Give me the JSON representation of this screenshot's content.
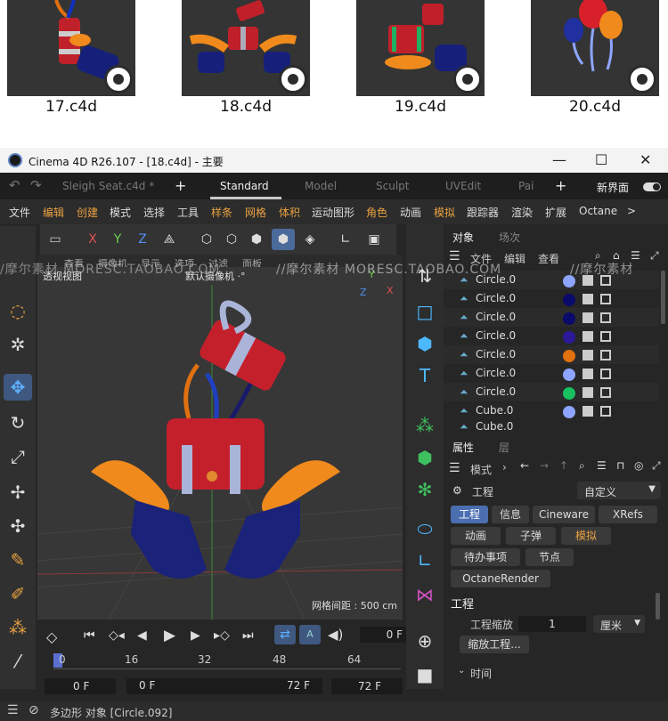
{
  "thumbnails": [
    {
      "caption": "17.c4d"
    },
    {
      "caption": "18.c4d"
    },
    {
      "caption": "19.c4d"
    },
    {
      "caption": "20.c4d"
    }
  ],
  "window": {
    "title": "Cinema 4D R26.107 - [18.c4d] - 主要",
    "minimize": "—",
    "maximize": "☐",
    "close": "✕"
  },
  "tabs": {
    "undo": "↶",
    "redo": "↷",
    "file": "Sleigh Seat.c4d *",
    "add": "+",
    "items": [
      "Standard",
      "Model",
      "Sculpt",
      "UVEdit",
      "Pai"
    ],
    "add2": "+",
    "new_ui": "新界面"
  },
  "menu": [
    "文件",
    "编辑",
    "创建",
    "模式",
    "选择",
    "工具",
    "样条",
    "网格",
    "体积",
    "运动图形",
    "角色",
    "动画",
    "模拟",
    "跟踪器",
    "渲染",
    "扩展",
    "Octane",
    ">"
  ],
  "axis": {
    "x": "X",
    "y": "Y",
    "z": "Z"
  },
  "viewport": {
    "menus": [
      "查看",
      "摄像机",
      "显示",
      "选项",
      "过滤",
      "面板"
    ],
    "view_name": "透视视图",
    "camera": "默认摄像机 ·°",
    "grid_spacing": "网格间距 : 500 cm",
    "axis_x": "X",
    "axis_y": "Y",
    "axis_z": "Z"
  },
  "watermark": [
    "/摩尔素材 MORESC.TAOBAO.COM",
    "//摩尔素材 MORESC.TAOBAO.COM",
    "//摩尔素材"
  ],
  "object_panel": {
    "tabs": [
      "对象",
      "场次"
    ],
    "menus": [
      "文件",
      "编辑",
      "查看"
    ],
    "rows": [
      {
        "name": "Circle.0",
        "color": "#8da5ff"
      },
      {
        "name": "Circle.0",
        "color": "#0a0a6a"
      },
      {
        "name": "Circle.0",
        "color": "#0a0a6a"
      },
      {
        "name": "Circle.0",
        "color": "#2a1a9a"
      },
      {
        "name": "Circle.0",
        "color": "#e07010"
      },
      {
        "name": "Circle.0",
        "color": "#8da5ff"
      },
      {
        "name": "Circle.0",
        "color": "#18c060"
      },
      {
        "name": "Cube.0",
        "color": "#8da5ff"
      },
      {
        "name": "Cube.0",
        "color": "#8da5ff"
      }
    ]
  },
  "attributes": {
    "tabs": [
      "属性",
      "层"
    ],
    "mode": "模式",
    "section": "工程",
    "preset": "自定义",
    "buttons_row1": [
      "工程",
      "信息",
      "Cineware",
      "XRefs"
    ],
    "buttons_row2": [
      "动画",
      "子弹",
      "模拟"
    ],
    "buttons_row3": [
      "待办事项",
      "节点"
    ],
    "buttons_row4": [
      "OctaneRender"
    ],
    "group": "工程",
    "scale_label": "工程缩放",
    "scale_value": "1",
    "scale_unit": "厘米",
    "scale_button": "缩放工程...",
    "time_label": "时间"
  },
  "timeline": {
    "ticks": [
      "0",
      "16",
      "32",
      "48",
      "64"
    ],
    "frame_current": "0 F",
    "start": "0 F",
    "range_start": "0 F",
    "range_end": "72 F",
    "end": "72 F"
  },
  "status": {
    "text": "多边形 对象 [Circle.092]"
  }
}
